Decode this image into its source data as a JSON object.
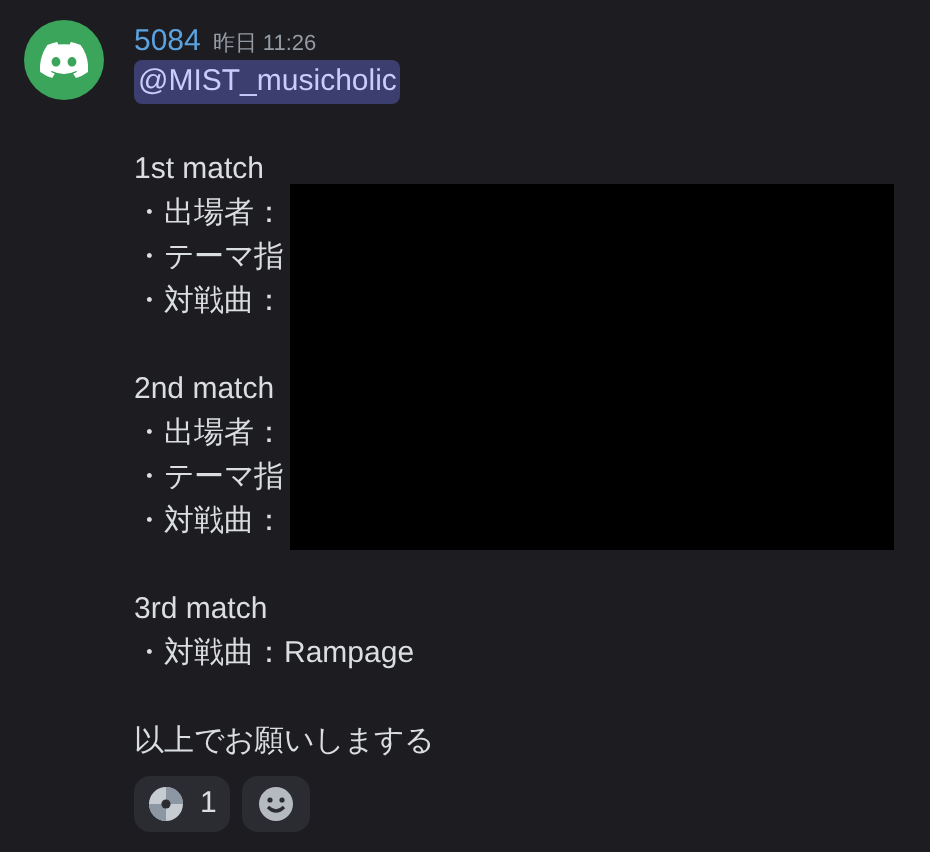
{
  "message": {
    "author": "5084",
    "timestamp": "昨日 11:26",
    "mention": "@MIST_musicholic",
    "blocks": [
      {
        "lines": [
          "1st match",
          "・出場者：",
          "・テーマ指",
          "・対戦曲："
        ]
      },
      {
        "lines": [
          "2nd match",
          "・出場者：",
          "・テーマ指",
          "・対戦曲："
        ]
      },
      {
        "lines": [
          "3rd match",
          "・対戦曲：Rampage"
        ]
      },
      {
        "lines": [
          "以上でお願いしまする"
        ]
      }
    ],
    "reactions": [
      {
        "kind": "disc",
        "count": "1"
      },
      {
        "kind": "add"
      }
    ]
  }
}
